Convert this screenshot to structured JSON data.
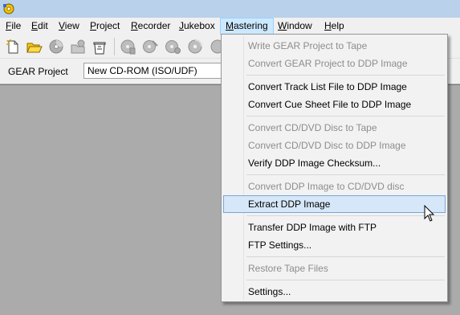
{
  "menubar": {
    "items": [
      {
        "label": "File",
        "accel": "F",
        "rest": "ile"
      },
      {
        "label": "Edit",
        "accel": "E",
        "rest": "dit"
      },
      {
        "label": "View",
        "accel": "V",
        "rest": "iew"
      },
      {
        "label": "Project",
        "accel": "P",
        "rest": "roject"
      },
      {
        "label": "Recorder",
        "accel": "R",
        "rest": "ecorder"
      },
      {
        "label": "Jukebox",
        "accel": "J",
        "rest": "ukebox"
      },
      {
        "label": "Mastering",
        "accel": "M",
        "rest": "astering"
      },
      {
        "label": "Window",
        "accel": "W",
        "rest": "indow"
      },
      {
        "label": "Help",
        "accel": "H",
        "rest": "elp"
      }
    ],
    "active": "Mastering"
  },
  "project_bar": {
    "label": "GEAR Project",
    "value": "New CD-ROM (ISO/UDF)"
  },
  "mastering_menu": {
    "items": [
      {
        "label": "Write GEAR Project to Tape",
        "enabled": false
      },
      {
        "label": "Convert GEAR Project to DDP Image",
        "enabled": false
      },
      {
        "label": "Convert Track List File to DDP Image",
        "enabled": true
      },
      {
        "label": "Convert Cue Sheet File to DDP Image",
        "enabled": true
      },
      {
        "label": "Convert CD/DVD Disc to Tape",
        "enabled": false
      },
      {
        "label": "Convert CD/DVD Disc to DDP Image",
        "enabled": false
      },
      {
        "label": "Verify DDP Image Checksum...",
        "enabled": true
      },
      {
        "label": "Convert DDP Image to CD/DVD disc",
        "enabled": false
      },
      {
        "label": "Extract DDP Image",
        "enabled": true,
        "highlighted": true
      },
      {
        "label": "Transfer DDP Image with FTP",
        "enabled": true
      },
      {
        "label": "FTP Settings...",
        "enabled": true
      },
      {
        "label": "Restore Tape Files",
        "enabled": false
      },
      {
        "label": "Settings...",
        "enabled": true
      }
    ]
  },
  "toolbar": {
    "icons": [
      "new-file-icon",
      "open-folder-icon",
      "disc-icon",
      "open-project-icon",
      "save-project-icon",
      "info-icon",
      "write-disc-icon",
      "settings-disc-icon",
      "disc-copy-icon"
    ]
  },
  "colors": {
    "titlebar": "#b9d1ea",
    "menu_highlight": "#cce8ff",
    "dropdown_bg": "#f2f2f2",
    "item_highlight": "#d5e7f8",
    "disabled_text": "#8d8d8d",
    "workarea": "#ababab"
  }
}
